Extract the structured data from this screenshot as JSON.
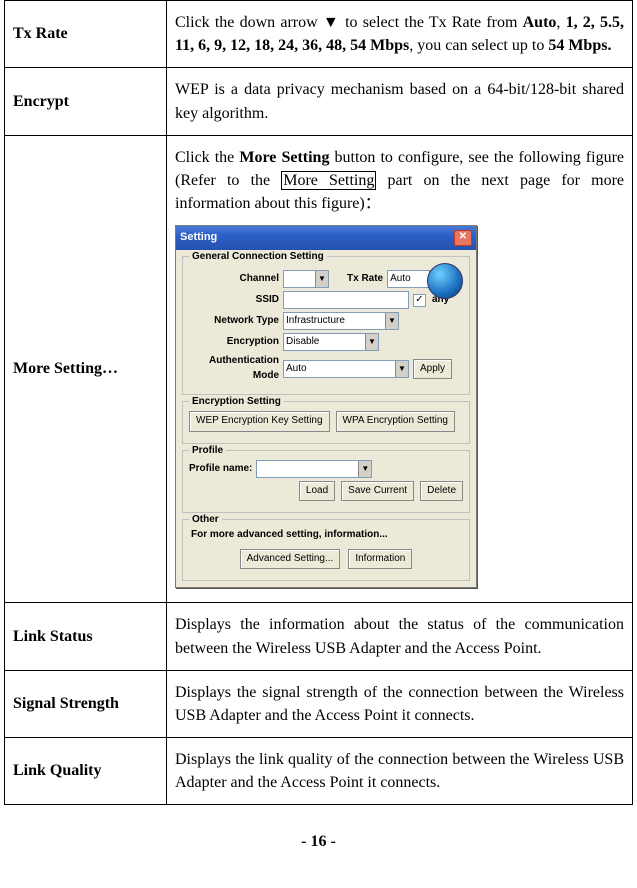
{
  "rows": {
    "tx_rate": {
      "label": "Tx Rate",
      "desc_prefix": "Click the down arrow ▼ to select the Tx Rate from ",
      "desc_bold1": "Auto",
      "desc_mid": ", ",
      "desc_bold2": "1, 2, 5.5, 11, 6, 9, 12, 18, 24, 36, 48, 54 Mbps",
      "desc_after": ", you can select up to ",
      "desc_bold3": "54 Mbps."
    },
    "encrypt": {
      "label": "Encrypt",
      "desc": "WEP is a data privacy mechanism based on a 64-bit/128-bit shared key algorithm."
    },
    "more_setting": {
      "label": "More Setting…",
      "desc_p1_a": "Click the ",
      "desc_p1_b": "More Setting",
      "desc_p1_c": " button to configure, see the following figure (Refer to the ",
      "desc_p1_link": "More Setting",
      "desc_p1_d": " part on the next page for more information about this figure)："
    },
    "link_status": {
      "label": "Link Status",
      "desc": "Displays the information about the status of the communication between the Wireless USB Adapter and the Access Point."
    },
    "signal_strength": {
      "label": "Signal Strength",
      "desc": "Displays the signal strength of the connection between the Wireless USB Adapter and the Access Point it connects."
    },
    "link_quality": {
      "label": "Link Quality",
      "desc": "Displays the link quality of the connection between the Wireless USB Adapter and the Access Point it connects."
    }
  },
  "dialog": {
    "title": "Setting",
    "groups": {
      "general": "General Connection Setting",
      "encryption": "Encryption Setting",
      "profile": "Profile",
      "other": "Other"
    },
    "labels": {
      "channel": "Channel",
      "tx_rate": "Tx Rate",
      "ssid": "SSID",
      "any": "any",
      "network_type": "Network Type",
      "encryption": "Encryption",
      "auth_mode": "Authentication Mode",
      "profile_name": "Profile name:",
      "other_text": "For more advanced setting, information..."
    },
    "values": {
      "channel": "",
      "tx_rate": "Auto",
      "network_type": "Infrastructure",
      "encryption": "Disable",
      "auth_mode": "Auto"
    },
    "buttons": {
      "apply": "Apply",
      "wep": "WEP Encryption Key Setting",
      "wpa": "WPA Encryption Setting",
      "load": "Load",
      "save": "Save Current",
      "delete": "Delete",
      "advanced": "Advanced Setting...",
      "information": "Information"
    }
  },
  "page_number": "- 16 -"
}
